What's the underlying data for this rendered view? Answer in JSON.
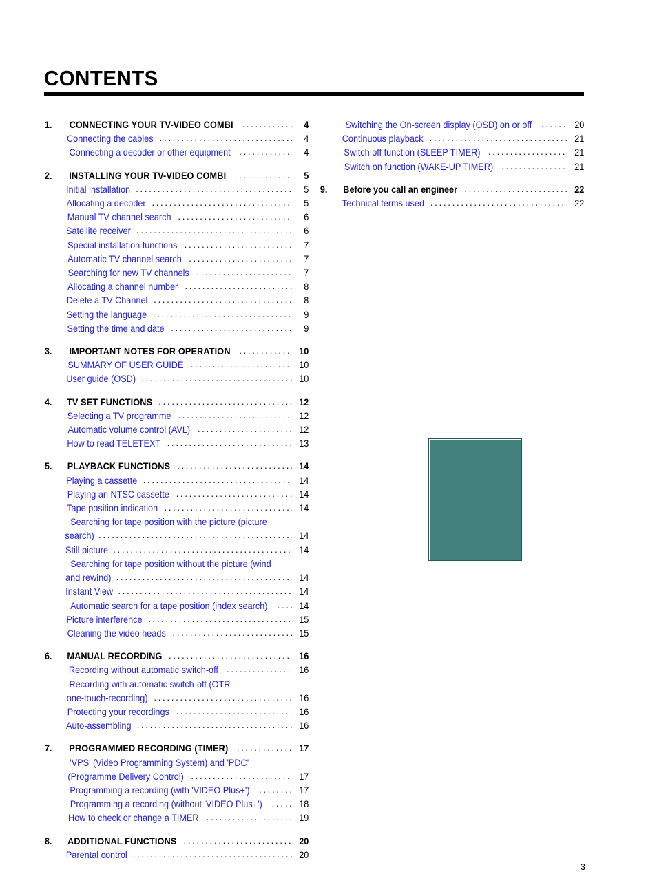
{
  "document": {
    "title": "CONTENTS",
    "folio": "3"
  },
  "figure": {
    "name": "teal-illustration-placeholder",
    "fill_color": "#43817f",
    "border_color": "#205a5c"
  },
  "colors": {
    "link_blue": "#2222d8",
    "heading_black": "#000000",
    "rule_black": "#000000"
  },
  "left_column": [
    {
      "number": "1.",
      "title": "CONNECTING YOUR TV-VIDEO COMBI",
      "page": "4",
      "items": [
        {
          "lines": [
            "Connecting the cables"
          ],
          "page": "4"
        },
        {
          "lines": [
            "Connecting a decoder or other equipment"
          ],
          "page": "4"
        }
      ]
    },
    {
      "number": "2.",
      "title": "INSTALLING YOUR TV-VIDEO COMBI",
      "page": "5",
      "items": [
        {
          "lines": [
            "Initial installation"
          ],
          "page": "5"
        },
        {
          "lines": [
            "Allocating a decoder"
          ],
          "page": "5"
        },
        {
          "lines": [
            "Manual TV channel search"
          ],
          "page": "6"
        },
        {
          "lines": [
            "Satellite receiver"
          ],
          "page": "6"
        },
        {
          "lines": [
            "Special installation functions"
          ],
          "page": "7"
        },
        {
          "lines": [
            "Automatic TV channel search"
          ],
          "page": "7"
        },
        {
          "lines": [
            "Searching for new TV channels"
          ],
          "page": "7"
        },
        {
          "lines": [
            "Allocating a channel number"
          ],
          "page": "8"
        },
        {
          "lines": [
            "Delete a TV Channel"
          ],
          "page": "8"
        },
        {
          "lines": [
            "Setting the language"
          ],
          "page": "9"
        },
        {
          "lines": [
            "Setting the time and date"
          ],
          "page": "9"
        }
      ]
    },
    {
      "number": "3.",
      "title": "IMPORTANT NOTES FOR OPERATION",
      "page": "10",
      "items": [
        {
          "lines": [
            "SUMMARY OF USER GUIDE"
          ],
          "page": "10"
        },
        {
          "lines": [
            "User guide (OSD)"
          ],
          "page": "10"
        }
      ]
    },
    {
      "number": "4.",
      "title": "TV SET FUNCTIONS",
      "page": "12",
      "items": [
        {
          "lines": [
            "Selecting a TV programme"
          ],
          "page": "12"
        },
        {
          "lines": [
            "Automatic volume control (AVL)"
          ],
          "page": "12"
        },
        {
          "lines": [
            "How to read TELETEXT"
          ],
          "page": "13"
        }
      ]
    },
    {
      "number": "5.",
      "title": "PLAYBACK FUNCTIONS",
      "page": "14",
      "items": [
        {
          "lines": [
            "Playing a cassette"
          ],
          "page": "14"
        },
        {
          "lines": [
            "Playing an NTSC cassette"
          ],
          "page": "14"
        },
        {
          "lines": [
            "Tape position indication"
          ],
          "page": "14"
        },
        {
          "lines": [
            "Searching for tape position with the picture (picture",
            "search)"
          ],
          "page": "14"
        },
        {
          "lines": [
            "Still picture"
          ],
          "page": "14"
        },
        {
          "lines": [
            "Searching for tape position without the picture (wind",
            "and rewind)"
          ],
          "page": "14"
        },
        {
          "lines": [
            "Instant View"
          ],
          "page": "14"
        },
        {
          "lines": [
            "Automatic search for a tape position (index search)"
          ],
          "page": "14"
        },
        {
          "lines": [
            "Picture interference"
          ],
          "page": "15"
        },
        {
          "lines": [
            "Cleaning the video heads"
          ],
          "page": "15"
        }
      ]
    },
    {
      "number": "6.",
      "title": "MANUAL RECORDING",
      "page": "16",
      "items": [
        {
          "lines": [
            "Recording without automatic switch-off"
          ],
          "page": "16"
        },
        {
          "lines": [
            "Recording with automatic switch-off (OTR",
            "one-touch-recording)"
          ],
          "page": "16"
        },
        {
          "lines": [
            "Protecting your recordings"
          ],
          "page": "16"
        },
        {
          "lines": [
            "Auto-assembling"
          ],
          "page": "16"
        }
      ]
    },
    {
      "number": "7.",
      "title": "PROGRAMMED RECORDING (TIMER)",
      "page": "17",
      "items": [
        {
          "lines": [
            "'VPS' (Video Programming System) and 'PDC'",
            "(Programme Delivery Control)"
          ],
          "page": "17"
        },
        {
          "lines": [
            "Programming a recording (with 'VIDEO Plus+')"
          ],
          "page": "17"
        },
        {
          "lines": [
            "Programming a recording (without 'VIDEO Plus+')"
          ],
          "page": "18"
        },
        {
          "lines": [
            "How to check or change a TIMER"
          ],
          "page": "19"
        }
      ]
    },
    {
      "number": "8.",
      "title": "ADDITIONAL FUNCTIONS",
      "page": "20",
      "items": [
        {
          "lines": [
            "Parental control"
          ],
          "page": "20"
        }
      ]
    }
  ],
  "right_column": [
    {
      "number": "",
      "title": "",
      "page": "",
      "continuation": true,
      "items": [
        {
          "lines": [
            "Switching the On-screen display (OSD) on or off"
          ],
          "page": "20"
        },
        {
          "lines": [
            "Continuous playback"
          ],
          "page": "21"
        },
        {
          "lines": [
            "Switch off function (SLEEP TIMER)"
          ],
          "page": "21"
        },
        {
          "lines": [
            "Switch on function (WAKE-UP TIMER)"
          ],
          "page": "21"
        }
      ]
    },
    {
      "number": "9.",
      "title": "Before you call an engineer",
      "title_case": "sentence",
      "page": "22",
      "items": [
        {
          "lines": [
            "Technical terms used"
          ],
          "page": "22"
        }
      ]
    }
  ]
}
